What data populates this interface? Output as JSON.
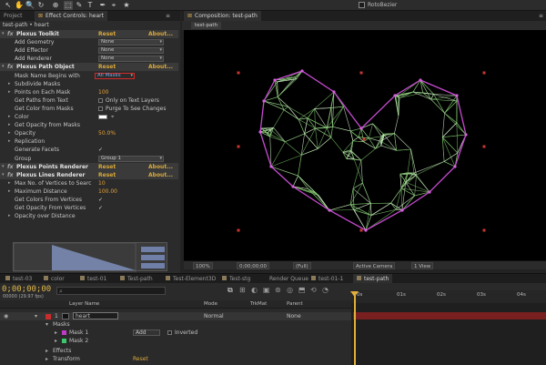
{
  "toolbar": {
    "tools": [
      "↖",
      "✋",
      "🔍",
      "↻",
      "⊕",
      "⬚",
      "✎",
      "T",
      "✒",
      "⌖",
      "★"
    ],
    "active_tool_index": 5,
    "roto_label": "RotoBezier"
  },
  "left_panel": {
    "tabs": [
      "Project",
      "Effect Controls: heart"
    ],
    "breadcrumb": "test-path • heart",
    "rows": [
      {
        "type": "hdr",
        "label": "Plexus Toolkit",
        "reset": "Reset",
        "about": "About..."
      },
      {
        "type": "dd",
        "label": "Add Geometry",
        "value": "None"
      },
      {
        "type": "dd",
        "label": "Add Effector",
        "value": "None"
      },
      {
        "type": "dd",
        "label": "Add Renderer",
        "value": "None"
      },
      {
        "type": "hdr",
        "label": "Plexus Path Object",
        "reset": "Reset",
        "about": "About..."
      },
      {
        "type": "link",
        "label": "Mask Name Begins with",
        "value": "All Masks"
      },
      {
        "type": "plain",
        "label": "Subdivide Masks"
      },
      {
        "type": "num",
        "label": "Points on Each Mask",
        "value": "100"
      },
      {
        "type": "cbx",
        "label": "Get Paths from Text",
        "value": "Only on Text Layers"
      },
      {
        "type": "cbx",
        "label": "Get Color from Masks",
        "value": "Purge To See Changes"
      },
      {
        "type": "color",
        "label": "Color"
      },
      {
        "type": "plain",
        "label": "Get Opacity from Masks"
      },
      {
        "type": "num",
        "label": "Opacity",
        "value": "50.0%"
      },
      {
        "type": "plain",
        "label": "Replication"
      },
      {
        "type": "check",
        "label": "Generate Facets"
      },
      {
        "type": "dd",
        "label": "Group",
        "value": "Group 1"
      },
      {
        "type": "hdr",
        "label": "Plexus Points Renderer",
        "reset": "Reset",
        "about": "About..."
      },
      {
        "type": "hdr",
        "label": "Plexus Lines Renderer",
        "reset": "Reset",
        "about": "About..."
      },
      {
        "type": "num",
        "label": "Max No. of Vertices to Searc",
        "value": "10"
      },
      {
        "type": "num",
        "label": "Maximum Distance",
        "value": "100.00"
      },
      {
        "type": "check",
        "label": "Get Colors From Vertices"
      },
      {
        "type": "check",
        "label": "Get Opacity From Vertices"
      },
      {
        "type": "plain",
        "label": "Opacity over Distance"
      }
    ]
  },
  "viewer": {
    "tab": "Composition: test-path",
    "subtab": "test-path",
    "bar": [
      "100%",
      "0;00;00;00",
      "(Full)",
      "Active Camera",
      "1 View"
    ]
  },
  "lower_tabs": [
    "test-03",
    "color",
    "test-01",
    "Test-path",
    "Test-Element3D",
    "Test-stg",
    "Render Queue",
    "test-01-1",
    "test-path"
  ],
  "timeline": {
    "timecode": "0;00;00;00",
    "fps": "00000 (29.97 fps)",
    "columns": [
      "Layer Name",
      "Mode",
      "TrkMat",
      "Parent"
    ],
    "ruler": [
      "0s",
      "01s",
      "02s",
      "03s",
      "04s"
    ],
    "layer": {
      "num": "1",
      "name": "heart",
      "mode": "Normal",
      "parent": "None"
    },
    "masks_label": "Masks",
    "masks": [
      {
        "name": "Mask 1",
        "mode": "Add",
        "inverted": "Inverted",
        "color": "#c23ac8"
      },
      {
        "name": "Mask 2",
        "color": "#3ac86a"
      }
    ],
    "effects_label": "Effects",
    "transform_label": "Transform",
    "transform_reset": "Reset"
  }
}
